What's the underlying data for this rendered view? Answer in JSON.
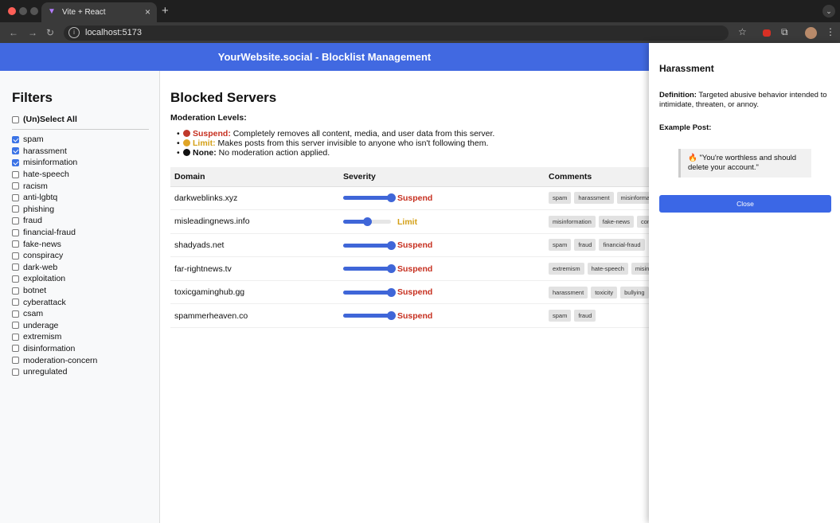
{
  "browser": {
    "tab_title": "Vite + React",
    "url": "localhost:5173"
  },
  "app": {
    "header_title": "YourWebsite.social - Blocklist Management"
  },
  "filters": {
    "title": "Filters",
    "select_all_label": "(Un)Select All",
    "items": [
      {
        "label": "spam",
        "checked": true
      },
      {
        "label": "harassment",
        "checked": true
      },
      {
        "label": "misinformation",
        "checked": true
      },
      {
        "label": "hate-speech",
        "checked": false
      },
      {
        "label": "racism",
        "checked": false
      },
      {
        "label": "anti-lgbtq",
        "checked": false
      },
      {
        "label": "phishing",
        "checked": false
      },
      {
        "label": "fraud",
        "checked": false
      },
      {
        "label": "financial-fraud",
        "checked": false
      },
      {
        "label": "fake-news",
        "checked": false
      },
      {
        "label": "conspiracy",
        "checked": false
      },
      {
        "label": "dark-web",
        "checked": false
      },
      {
        "label": "exploitation",
        "checked": false
      },
      {
        "label": "botnet",
        "checked": false
      },
      {
        "label": "cyberattack",
        "checked": false
      },
      {
        "label": "csam",
        "checked": false
      },
      {
        "label": "underage",
        "checked": false
      },
      {
        "label": "extremism",
        "checked": false
      },
      {
        "label": "disinformation",
        "checked": false
      },
      {
        "label": "moderation-concern",
        "checked": false
      },
      {
        "label": "unregulated",
        "checked": false
      }
    ]
  },
  "main": {
    "title": "Blocked Servers",
    "levels_heading": "Moderation Levels:",
    "levels": [
      {
        "name": "Suspend:",
        "desc": " Completely removes all content, media, and user data from this server.",
        "color": "#c0392b"
      },
      {
        "name": "Limit:",
        "desc": " Makes posts from this server invisible to anyone who isn't following them.",
        "color": "#e0a526"
      },
      {
        "name": "None:",
        "desc": " No moderation action applied.",
        "color": "#111111"
      }
    ],
    "columns": {
      "domain": "Domain",
      "severity": "Severity",
      "comments": "Comments"
    },
    "rows": [
      {
        "domain": "darkweblinks.xyz",
        "severity": "Suspend",
        "level": 1.0,
        "tags": [
          "spam",
          "harassment",
          "misinformation"
        ]
      },
      {
        "domain": "misleadingnews.info",
        "severity": "Limit",
        "level": 0.5,
        "tags": [
          "misinformation",
          "fake-news",
          "conspiracy"
        ]
      },
      {
        "domain": "shadyads.net",
        "severity": "Suspend",
        "level": 1.0,
        "tags": [
          "spam",
          "fraud",
          "financial-fraud"
        ]
      },
      {
        "domain": "far-rightnews.tv",
        "severity": "Suspend",
        "level": 1.0,
        "tags": [
          "extremism",
          "hate-speech",
          "misinformation"
        ]
      },
      {
        "domain": "toxicgaminghub.gg",
        "severity": "Suspend",
        "level": 1.0,
        "tags": [
          "harassment",
          "toxicity",
          "bullying"
        ]
      },
      {
        "domain": "spammerheaven.co",
        "severity": "Suspend",
        "level": 1.0,
        "tags": [
          "spam",
          "fraud"
        ]
      }
    ],
    "severity_colors": {
      "Suspend": "#c62f1f",
      "Limit": "#d4a017"
    }
  },
  "drawer": {
    "title": "Harassment",
    "definition_label": "Definition:",
    "definition_text": " Targeted abusive behavior intended to intimidate, threaten, or annoy.",
    "example_label": "Example Post:",
    "example_emoji": "🔥",
    "example_text": " \"You're worthless and should delete your account.\"",
    "close_label": "Close"
  }
}
